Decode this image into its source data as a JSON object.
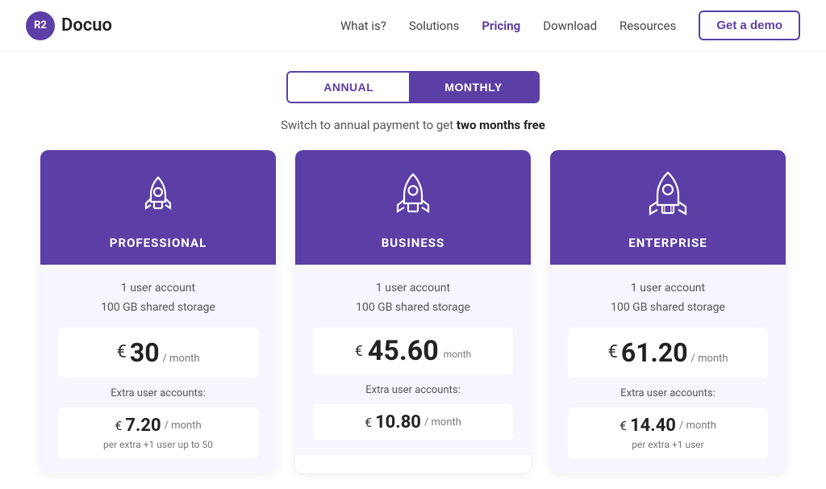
{
  "header": {
    "logo_text": "Docuo",
    "logo_icon": "R2",
    "nav": [
      {
        "label": "What is?",
        "active": false
      },
      {
        "label": "Solutions",
        "active": false
      },
      {
        "label": "Pricing",
        "active": true
      },
      {
        "label": "Download",
        "active": false
      },
      {
        "label": "Resources",
        "active": false
      }
    ],
    "cta_label": "Get a demo"
  },
  "toggle": {
    "annual_label": "ANNUAL",
    "monthly_label": "MONTHLY",
    "active": "monthly"
  },
  "subtitle": {
    "prefix": "Switch to annual payment to get ",
    "highlight": "two months free"
  },
  "cards": [
    {
      "id": "professional",
      "title": "PROFESSIONAL",
      "icon": "rocket-small",
      "feature1": "1 user account",
      "feature2": "100 GB shared storage",
      "price_currency": "€",
      "price_amount": "30",
      "price_period": "/ month",
      "extra_label": "Extra user accounts:",
      "extra_currency": "€",
      "extra_amount": "7.20",
      "extra_period": "/ month",
      "extra_note": "per extra +1 user up to 50"
    },
    {
      "id": "business",
      "title": "BUSINESS",
      "icon": "rocket-medium",
      "feature1": "1 user account",
      "feature2": "100 GB shared storage",
      "price_currency": "€",
      "price_amount": "45.60",
      "price_period": "month",
      "extra_label": "Extra user accounts:",
      "extra_currency": "€",
      "extra_amount": "10.80",
      "extra_period": "/ month",
      "extra_note": ""
    },
    {
      "id": "enterprise",
      "title": "ENTERPRISE",
      "icon": "rocket-large",
      "feature1": "1 user account",
      "feature2": "100 GB shared storage",
      "price_currency": "€",
      "price_amount": "61.20",
      "price_period": "/ month",
      "extra_label": "Extra user accounts:",
      "extra_currency": "€",
      "extra_amount": "14.40",
      "extra_period": "/ month",
      "extra_note": "per extra +1 user"
    }
  ],
  "colors": {
    "purple": "#5b3fa6",
    "light_purple_bg": "#f7f5ff"
  }
}
